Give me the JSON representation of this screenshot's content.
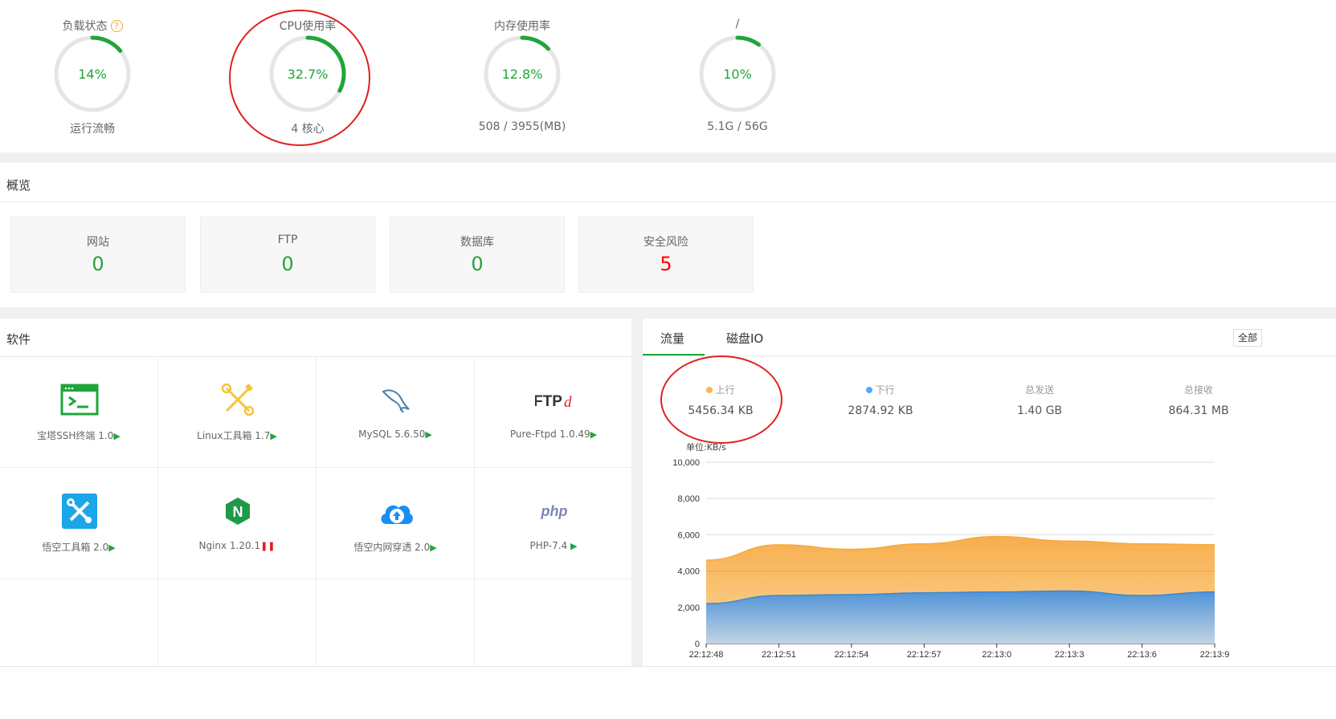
{
  "gauges": [
    {
      "title": "负载状态",
      "value_text": "14%",
      "percent": 14,
      "sub": "运行流畅",
      "has_help": true
    },
    {
      "title": "CPU使用率",
      "value_text": "32.7%",
      "percent": 32.7,
      "sub": "4 核心"
    },
    {
      "title": "内存使用率",
      "value_text": "12.8%",
      "percent": 12.8,
      "sub": "508 / 3955(MB)"
    },
    {
      "title": "/",
      "value_text": "10%",
      "percent": 10,
      "sub": "5.1G / 56G"
    }
  ],
  "help_icon": "?",
  "overview": {
    "title": "概览",
    "items": [
      {
        "label": "网站",
        "value": "0"
      },
      {
        "label": "FTP",
        "value": "0"
      },
      {
        "label": "数据库",
        "value": "0"
      },
      {
        "label": "安全风险",
        "value": "5"
      }
    ]
  },
  "software": {
    "title": "软件",
    "items": [
      {
        "name": "宝塔SSH终端 1.0",
        "icon": "terminal-icon",
        "status": "play"
      },
      {
        "name": "Linux工具箱 1.7",
        "icon": "tools-icon",
        "status": "play"
      },
      {
        "name": "MySQL 5.6.50",
        "icon": "mysql-dolphin-icon",
        "status": "play"
      },
      {
        "name": "Pure-Ftpd 1.0.49",
        "icon": "ftpd-icon",
        "status": "play"
      },
      {
        "name": "悟空工具箱 2.0",
        "icon": "wrench-icon",
        "status": "play"
      },
      {
        "name": "Nginx 1.20.1",
        "icon": "nginx-icon",
        "status": "stopped"
      },
      {
        "name": "悟空内网穿透 2.0",
        "icon": "cloud-upload-icon",
        "status": "play"
      },
      {
        "name": "PHP-7.4",
        "icon": "php-icon",
        "status": "play"
      }
    ],
    "play_glyph": "▶",
    "pause_glyph": "❚❚"
  },
  "traffic": {
    "tabs": [
      "流量",
      "磁盘IO"
    ],
    "all_button": "全部",
    "stats": [
      {
        "label": "上行",
        "value": "5456.34 KB",
        "color": "#f7b851"
      },
      {
        "label": "下行",
        "value": "2874.92 KB",
        "color": "#52a9ff"
      },
      {
        "label": "总发送",
        "value": "1.40 GB"
      },
      {
        "label": "总接收",
        "value": "864.31 MB"
      }
    ]
  },
  "chart_data": {
    "type": "area",
    "ylabel": "单位:KB/s",
    "ylim": [
      0,
      10000
    ],
    "yticks": [
      "0",
      "2,000",
      "4,000",
      "6,000",
      "8,000",
      "10,000"
    ],
    "x": [
      "22:12:48",
      "22:12:51",
      "22:12:54",
      "22:12:57",
      "22:13:0",
      "22:13:3",
      "22:13:6",
      "22:13:9"
    ],
    "grid": true,
    "series": [
      {
        "name": "上行",
        "color": "#f7b851",
        "values": [
          4600,
          5450,
          5200,
          5500,
          5900,
          5650,
          5500,
          5450
        ]
      },
      {
        "name": "下行",
        "color": "#52a9ff",
        "values": [
          2200,
          2650,
          2700,
          2800,
          2850,
          2900,
          2650,
          2850
        ]
      }
    ]
  }
}
